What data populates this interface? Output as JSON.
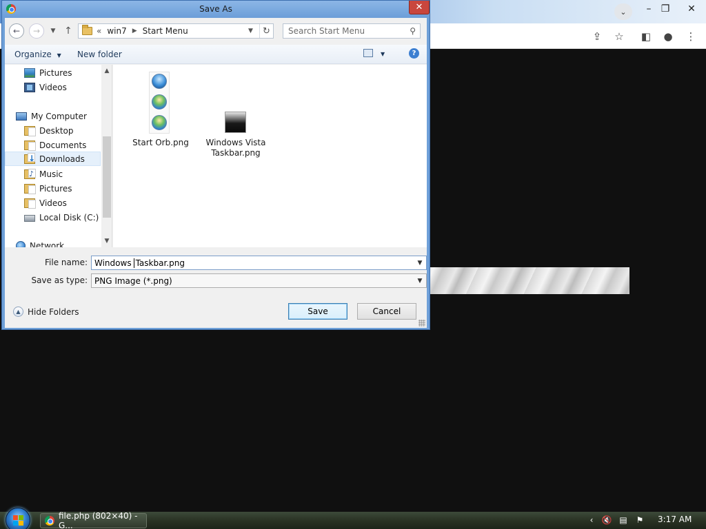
{
  "dialog": {
    "title": "Save As",
    "address": {
      "root_chevron": "«",
      "segments": [
        "win7",
        "Start Menu"
      ]
    },
    "search_placeholder": "Search Start Menu",
    "commands": {
      "organize": "Organize",
      "new_folder": "New folder"
    },
    "nav_items": [
      {
        "label": "Pictures",
        "icon": "pictures-icon"
      },
      {
        "label": "Videos",
        "icon": "videos-icon"
      },
      {
        "label": "My Computer",
        "icon": "computer-icon"
      },
      {
        "label": "Desktop",
        "icon": "folder-icon"
      },
      {
        "label": "Documents",
        "icon": "documents-icon"
      },
      {
        "label": "Downloads",
        "icon": "downloads-icon",
        "selected": true
      },
      {
        "label": "Music",
        "icon": "music-icon"
      },
      {
        "label": "Pictures",
        "icon": "pictures-icon"
      },
      {
        "label": "Videos",
        "icon": "videos-icon"
      },
      {
        "label": "Local Disk (C:)",
        "icon": "disk-icon"
      },
      {
        "label": "Network",
        "icon": "network-icon"
      }
    ],
    "files": [
      {
        "name": "Start Orb.png"
      },
      {
        "name_line1": "Windows Vista",
        "name_line2": "Taskbar.png"
      }
    ],
    "file_name": {
      "label": "File name:",
      "value_before_caret": "Windows",
      "value_after_caret": "Taskbar.png"
    },
    "save_type": {
      "label": "Save as type:",
      "value": "PNG Image (*.png)"
    },
    "hide_folders": "Hide Folders",
    "buttons": {
      "save": "Save",
      "cancel": "Cancel"
    }
  },
  "taskbar": {
    "task": "file.php (802×40) - G...",
    "clock": "3:17 AM"
  },
  "colors": {
    "accent": "#6fa0d8",
    "close": "#c9463d",
    "selection": "#e5f0fb"
  }
}
